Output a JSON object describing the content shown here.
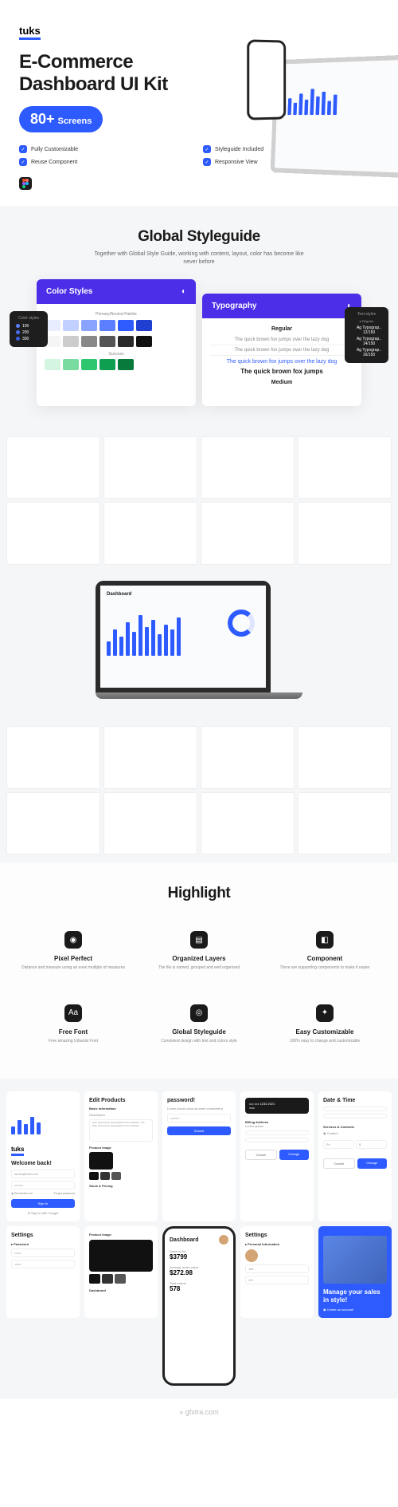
{
  "logo": "tuks",
  "hero": {
    "title_line1": "E-Commerce",
    "title_line2": "Dashboard UI Kit",
    "badge_num": "80+",
    "badge_txt": "Screens",
    "features": [
      "Fully Customizable",
      "Styleguide Included",
      "Reuse Component",
      "Responsive View"
    ]
  },
  "styleguide": {
    "title": "Global Styleguide",
    "sub": "Together with Global Style Guide, working with content, layout, color has become like never before",
    "card1_title": "Color Styles",
    "card1_sub": "Primary/Neutral Palette",
    "card2_title": "Typography",
    "card2_reg": "Regular",
    "card2_med": "Medium",
    "card2_sample": "The quick brown fox jumps over the lazy dog",
    "card2_sample2": "The quick brown fox jumps",
    "popup_left_title": "Color styles",
    "popup_left_items": [
      "100",
      "200",
      "300"
    ],
    "popup_right_title": "Text styles",
    "popup_right_sub": "Regular",
    "popup_right_items": [
      "Typograp.. 12/150",
      "Typograp.. 14/150",
      "Typograp.. 16/150"
    ]
  },
  "highlight": {
    "title": "Highlight",
    "items": [
      {
        "icon": "◉",
        "t": "Pixel Perfect",
        "d": "Distance and measure using an even multiple of measures"
      },
      {
        "icon": "▤",
        "t": "Organized Layers",
        "d": "The file is named, grouped and well organized"
      },
      {
        "icon": "◧",
        "t": "Component",
        "d": "There are supporting components to make it easier"
      },
      {
        "icon": "Aa",
        "t": "Free Font",
        "d": "Free amazing Urbanist Font"
      },
      {
        "icon": "◎",
        "t": "Global Styleguide",
        "d": "Consistent design with text and colors style"
      },
      {
        "icon": "✦",
        "t": "Easy Customizable",
        "d": "100% easy to change and customizable"
      }
    ]
  },
  "bottom": {
    "welcome_title": "Welcome back!",
    "email": "name@mail.com",
    "remember": "Remember me",
    "forgot": "Forgot password",
    "signin": "Sign In",
    "google": "Sign in with Google",
    "edit_title": "Edit Products",
    "basic": "Basic information",
    "desc_label": "Description",
    "desc_text": "Nike Sportswear Heritage86 Futura Washed. The Nike Sportswear Heritage86 Futura Washed",
    "pimg": "Product Image",
    "stock": "Stock & Pricing",
    "settings_title": "Settings",
    "password": "Password",
    "passhint": "password!",
    "submit": "Submit",
    "dash_title": "Dashboard",
    "sales_lbl": "Sales of All",
    "sales_val": "$3799",
    "avg_lbl": "Average order value",
    "avg_val": "$272.98",
    "orders_lbl": "Total orders",
    "orders_val": "578",
    "personal": "Personal Information",
    "name": "Jeff",
    "country": "US",
    "billing": "Billing Address",
    "lorem": "Lorem Ipsum",
    "change": "Change",
    "cancel": "Cancel",
    "datetime": "Date & Time",
    "services": "Services & Contents",
    "content": "Content",
    "manage": "Manage your sales in style!",
    "create": "Create an account!"
  },
  "watermark": "» gfxtra.com"
}
